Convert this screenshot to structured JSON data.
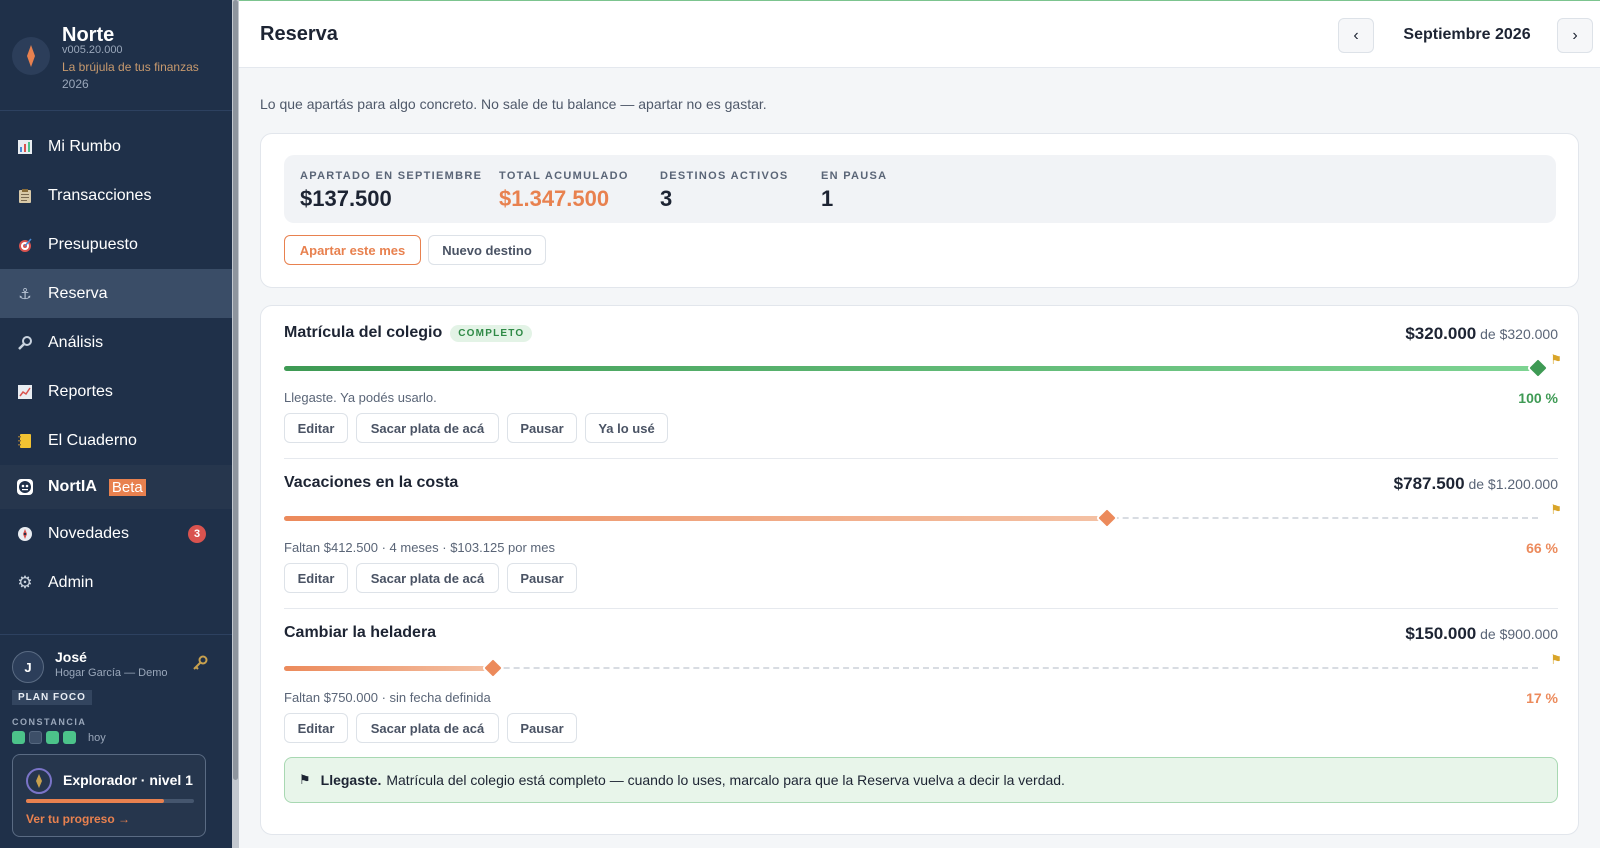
{
  "brand": {
    "name": "Norte",
    "version": "v005.20.000",
    "tagline": "La brújula de tus finanzas",
    "year": "2026"
  },
  "nav": {
    "items": [
      {
        "label": "Mi Rumbo",
        "icon": "chart-icon"
      },
      {
        "label": "Transacciones",
        "icon": "clipboard-icon"
      },
      {
        "label": "Presupuesto",
        "icon": "target-icon"
      },
      {
        "label": "Reserva",
        "icon": "anchor-icon"
      },
      {
        "label": "Análisis",
        "icon": "magnifier-icon"
      },
      {
        "label": "Reportes",
        "icon": "trend-icon"
      },
      {
        "label": "El Cuaderno",
        "icon": "notebook-icon"
      },
      {
        "label": "NortIA",
        "icon": "robot-icon",
        "badge": "Beta"
      },
      {
        "label": "Novedades",
        "icon": "compass-icon",
        "count": "3"
      },
      {
        "label": "Admin",
        "icon": "gear-icon"
      }
    ],
    "active": "Reserva"
  },
  "user": {
    "initial": "J",
    "name": "José",
    "household": "Hogar García — Demo",
    "plan": "PLAN FOCO",
    "constancia_label": "CONSTANCIA",
    "constancia_days": [
      true,
      false,
      true,
      true
    ],
    "constancia_today": "hoy",
    "level_title": "Explorador · nivel 1",
    "level_progress": 0.82,
    "level_link": "Ver tu progreso →"
  },
  "header": {
    "title": "Reserva",
    "month": "Septiembre 2026",
    "prev": "‹",
    "next": "›"
  },
  "intro": "Lo que apartás para algo concreto. No sale de tu balance — apartar no es gastar.",
  "summary": {
    "stats": [
      {
        "label": "APARTADO EN SEPTIEMBRE",
        "value": "$137.500"
      },
      {
        "label": "TOTAL ACUMULADO",
        "value": "$1.347.500"
      },
      {
        "label": "DESTINOS ACTIVOS",
        "value": "3"
      },
      {
        "label": "EN PAUSA",
        "value": "1"
      }
    ],
    "btn_apartar": "Apartar este mes",
    "btn_nuevo": "Nuevo destino"
  },
  "goals": [
    {
      "name": "Matrícula del colegio",
      "badge": "COMPLETO",
      "saved": "$320.000",
      "of": "de $320.000",
      "progress": 1.0,
      "status": "Llegaste. Ya podés usarlo.",
      "pct": "100 %",
      "actions": [
        "Editar",
        "Sacar plata de acá",
        "Pausar",
        "Ya lo usé"
      ]
    },
    {
      "name": "Vacaciones en la costa",
      "saved": "$787.500",
      "of": "de $1.200.000",
      "progress": 0.656,
      "status": "Faltan $412.500 · 4 meses · $103.125 por mes",
      "pct": "66 %",
      "actions": [
        "Editar",
        "Sacar plata de acá",
        "Pausar"
      ]
    },
    {
      "name": "Cambiar la heladera",
      "saved": "$150.000",
      "of": "de $900.000",
      "progress": 0.167,
      "status": "Faltan $750.000 · sin fecha definida",
      "pct": "17 %",
      "actions": [
        "Editar",
        "Sacar plata de acá",
        "Pausar"
      ]
    }
  ],
  "notice": {
    "flag": "⚑",
    "strong": "Llegaste.",
    "text": "Matrícula del colegio está completo — cuando lo uses, marcalo para que la Reserva vuelva a decir la verdad."
  },
  "colors": {
    "sidebar": "#1f3049",
    "accent": "#e8814f",
    "success": "#3e9a54"
  }
}
